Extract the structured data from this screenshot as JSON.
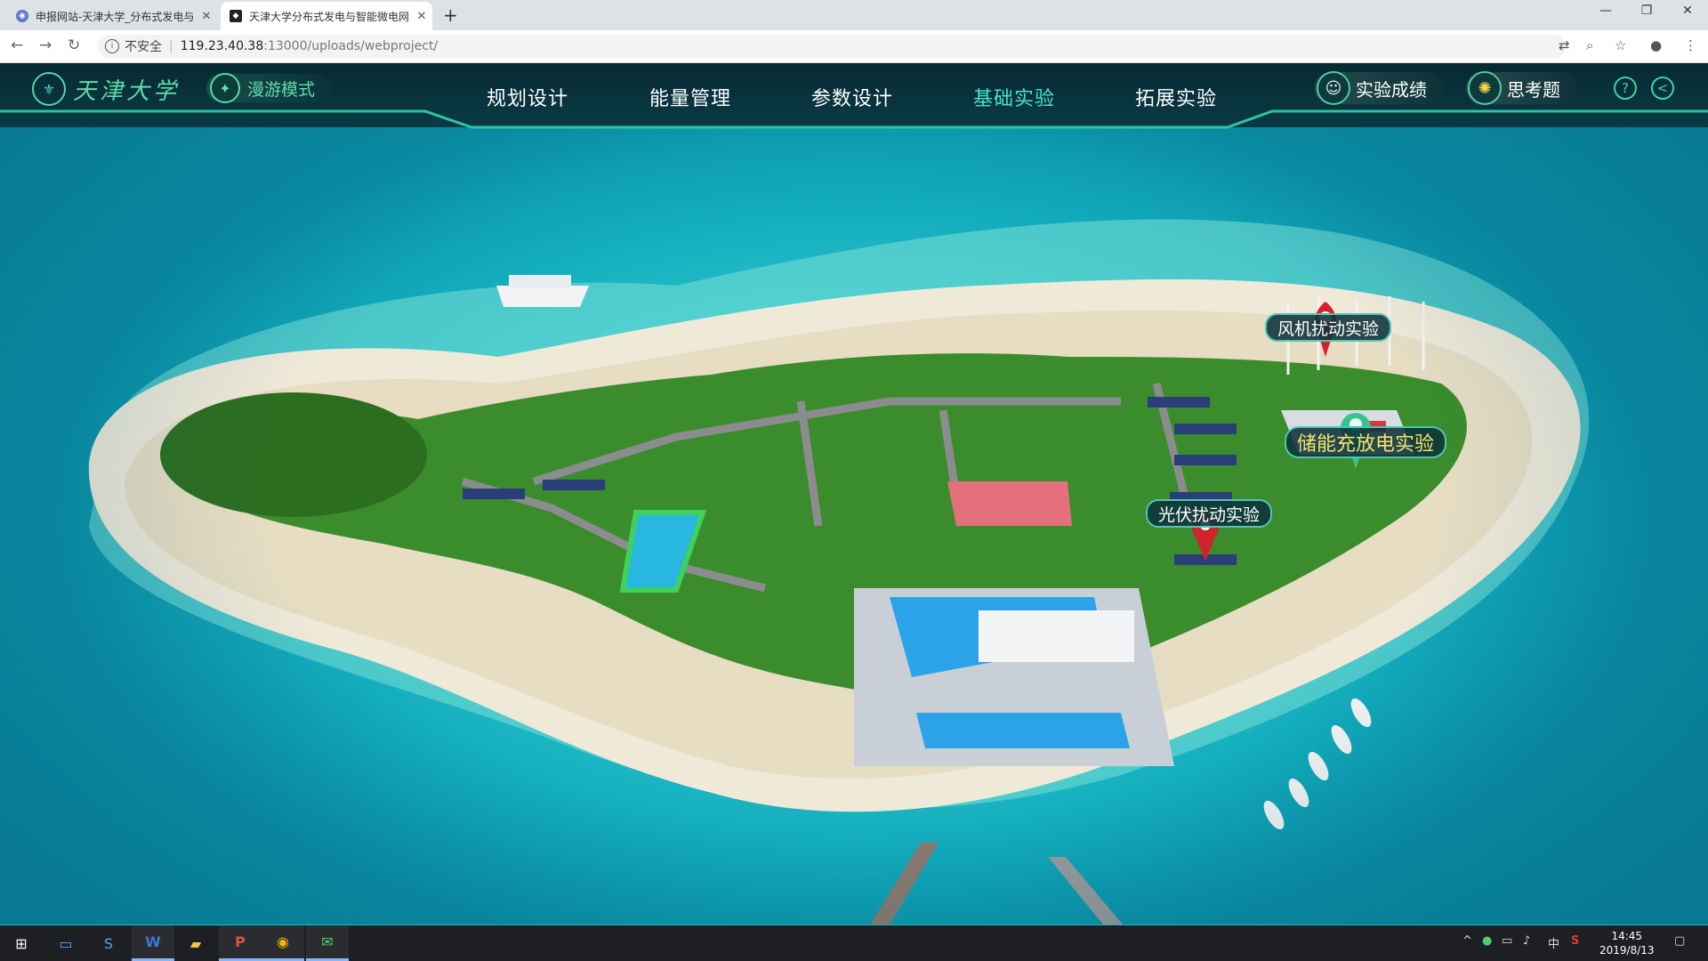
{
  "browser": {
    "tabs": [
      {
        "title": "申报网站-天津大学_分布式发电与",
        "close": "✕"
      },
      {
        "title": "天津大学分布式发电与智能微电网",
        "close": "✕"
      }
    ],
    "new_tab": "+",
    "window_controls": {
      "minimize": "—",
      "restore": "❐",
      "close": "✕"
    },
    "nav": {
      "back": "←",
      "forward": "→",
      "reload": "↻"
    },
    "address": {
      "security_label": "不安全",
      "separator": "|",
      "host": "119.23.40.38",
      "path": ":13000/uploads/webproject/"
    }
  },
  "app": {
    "logo_text": "天津大学",
    "roam_mode": "漫游模式",
    "nav_items": [
      "规划设计",
      "能量管理",
      "参数设计",
      "基础实验",
      "拓展实验"
    ],
    "active_nav": "基础实验",
    "score_button": "实验成绩",
    "question_button": "思考题",
    "help_symbol": "?",
    "back_symbol": "<",
    "markers": {
      "wind": "风机扰动实验",
      "storage": "储能充放电实验",
      "pv": "光伏扰动实验"
    },
    "colors": {
      "accent": "#45e2cf",
      "marker_red": "#d2222b",
      "marker_green": "#37c48a",
      "gold_text": "#f5e36a"
    }
  },
  "taskbar": {
    "clock_time": "14:45",
    "clock_date": "2019/8/13",
    "ime": "中"
  }
}
